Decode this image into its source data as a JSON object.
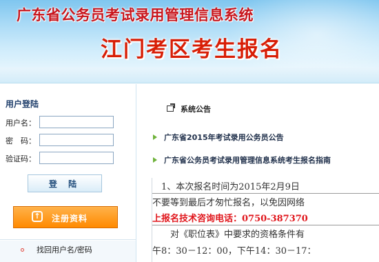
{
  "header": {
    "system_title": "广东省公务员考试录用管理信息系统",
    "page_title": "江门考区考生报名"
  },
  "login": {
    "title": "用户登陆",
    "username_label": "用户名：",
    "password_label": "密　码：",
    "captcha_label": "验证码：",
    "username_value": "",
    "password_value": "",
    "captcha_value": "",
    "login_button": "登 陆",
    "register_button": "注册资料",
    "find_link": "找回用户名/密码"
  },
  "notices": {
    "section_title": "系统公告",
    "items": [
      "广东省2015年考试录用公务员公告",
      "广东省公务员考试录用管理信息系统考生报名指南"
    ]
  },
  "content": {
    "line1": "　1、本次报名时间为2015年2月9日",
    "line2": "不要等到最后才匆忙报名，以免因网络",
    "line3": "上报名技术咨询电话：0750-387370",
    "line4": "　　对《职位表》中要求的资格条件有",
    "line5": "午8：30－12：00，下午14：30－17："
  },
  "colors": {
    "title_red": "#c8161d",
    "accent_orange": "#ff8a00",
    "bullet_green": "#6fb23b",
    "phone_red": "#e0151b"
  }
}
